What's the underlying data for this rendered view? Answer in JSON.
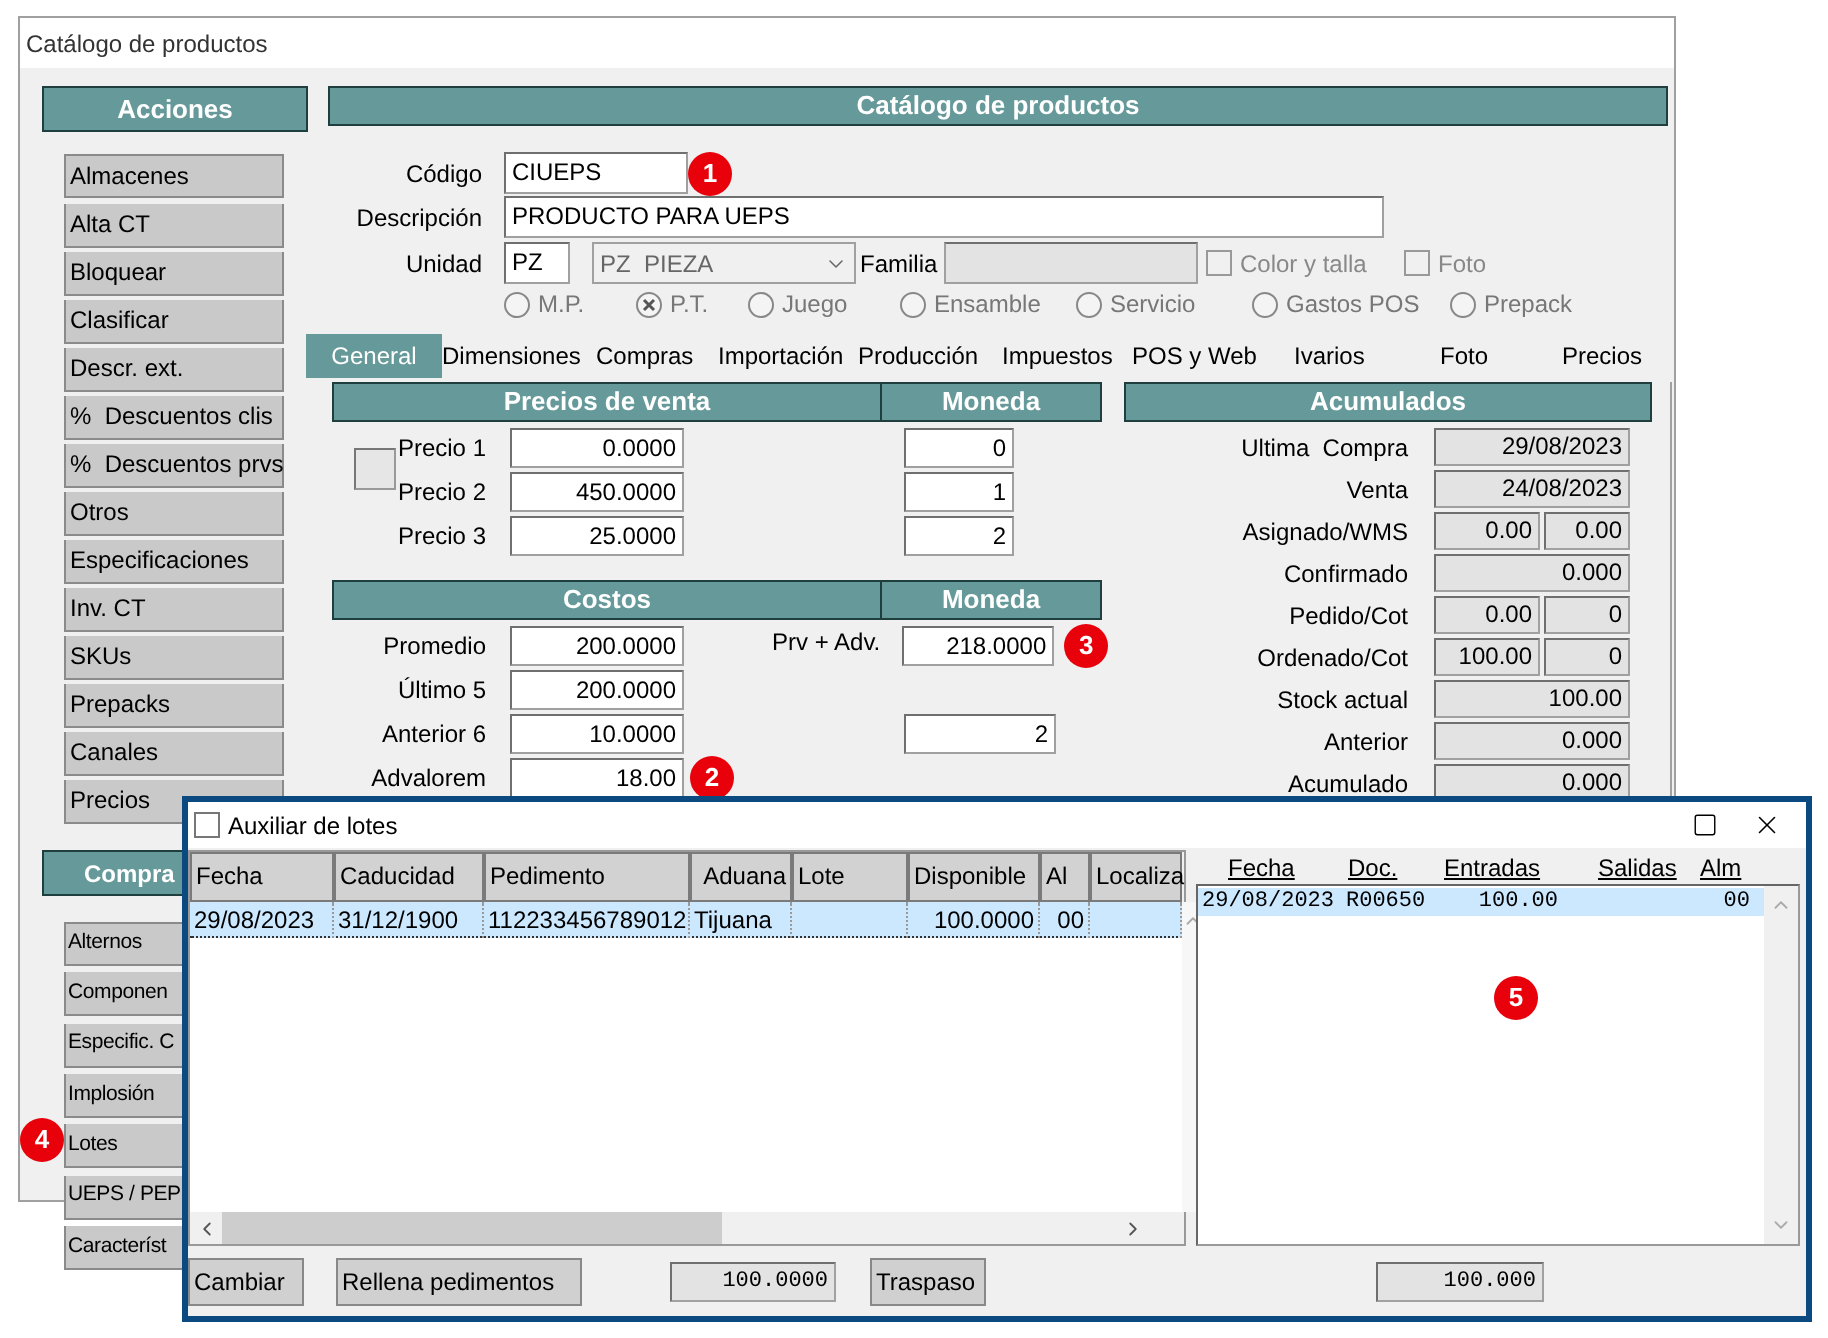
{
  "window": {
    "title": "Catálogo de productos"
  },
  "sidebar": [
    {
      "title": "Acciones",
      "items": [
        {
          "label": "Almacenes"
        },
        {
          "label": "Alta CT"
        },
        {
          "label": "Bloquear"
        },
        {
          "label": "Clasificar"
        },
        {
          "label": "Descr. ext."
        },
        {
          "label": "%  Descuentos clis"
        },
        {
          "label": "%  Descuentos prvs"
        },
        {
          "label": "Otros"
        },
        {
          "label": "Especificaciones"
        },
        {
          "label": "Inv. CT"
        },
        {
          "label": "SKUs"
        },
        {
          "label": "Prepacks"
        },
        {
          "label": "Canales"
        },
        {
          "label": "Precios"
        }
      ]
    },
    {
      "title": "Compra",
      "items": [
        {
          "label": "Alternos"
        },
        {
          "label": "Componen"
        },
        {
          "label": "Especific. C"
        },
        {
          "label": "Implosión"
        },
        {
          "label": "Lotes",
          "marker": "4"
        },
        {
          "label": "UEPS / PEP"
        },
        {
          "label": "Característ"
        }
      ]
    }
  ],
  "product": {
    "title": "Catálogo de productos",
    "code": {
      "label": "Código",
      "value": "CIUEPS",
      "marker": "1"
    },
    "description": {
      "label": "Descripción",
      "value": "PRODUCTO PARA UEPS"
    },
    "unit": {
      "label": "Unidad",
      "value": "PZ",
      "select": "PZ  PIEZA"
    },
    "family": {
      "label": "Familia",
      "disabled": true
    },
    "checkboxes": [
      {
        "label": "Color y talla",
        "checked": false,
        "disabled": true
      },
      {
        "label": "Foto",
        "checked": false,
        "disabled": true
      }
    ],
    "types": [
      {
        "label": "M.P.",
        "selected": false
      },
      {
        "label": "P.T.",
        "selected": true
      },
      {
        "label": "Juego",
        "selected": false
      },
      {
        "label": "Ensamble",
        "selected": false
      },
      {
        "label": "Servicio",
        "selected": false
      },
      {
        "label": "Gastos POS",
        "selected": false
      },
      {
        "label": "Prepack",
        "selected": false
      }
    ],
    "tabs": [
      {
        "label": "General",
        "selected": true
      },
      {
        "label": "Dimensiones",
        "selected": false
      },
      {
        "label": "Compras",
        "selected": false
      },
      {
        "label": "Importación",
        "selected": false
      },
      {
        "label": "Producción",
        "selected": false
      },
      {
        "label": "Impuestos",
        "selected": false
      },
      {
        "label": "POS y Web",
        "selected": false
      },
      {
        "label": "Ivarios",
        "selected": false
      },
      {
        "label": "Foto",
        "selected": false
      },
      {
        "label": "Precios",
        "selected": false
      }
    ],
    "sale_prices": {
      "title": "Precios de venta",
      "currency_title": "Moneda",
      "rows": [
        {
          "label": "Precio 1",
          "value": "0.0000",
          "currency": "0"
        },
        {
          "label": "Precio 2",
          "value": "450.0000",
          "currency": "1"
        },
        {
          "label": "Precio 3",
          "value": "25.0000",
          "currency": "2"
        }
      ]
    },
    "costs": {
      "title": "Costos",
      "currency_title": "Moneda",
      "rows": [
        {
          "label": "Promedio",
          "value": "200.0000",
          "side": {
            "label": "Prv + Adv.",
            "value": "218.0000",
            "marker": "3"
          }
        },
        {
          "label": "Último 5",
          "value": "200.0000"
        },
        {
          "label": "Anterior 6",
          "value": "10.0000",
          "currency": "2"
        },
        {
          "label": "Advalorem",
          "value": "18.00",
          "marker": "2"
        }
      ]
    },
    "accumulated": {
      "title": "Acumulados",
      "rows": [
        {
          "label": "Ultima  Compra",
          "values": [
            "29/08/2023"
          ]
        },
        {
          "label": "Venta",
          "values": [
            "24/08/2023"
          ]
        },
        {
          "label": "Asignado/WMS",
          "values": [
            "0.00",
            "0.00"
          ]
        },
        {
          "label": "Confirmado",
          "values": [
            "0.000"
          ]
        },
        {
          "label": "Pedido/Cot",
          "values": [
            "0.00",
            "0"
          ]
        },
        {
          "label": "Ordenado/Cot",
          "values": [
            "100.00",
            "0"
          ]
        },
        {
          "label": "Stock actual",
          "values": [
            "100.00"
          ]
        },
        {
          "label": "Anterior",
          "values": [
            "0.000"
          ]
        },
        {
          "label": "Acumulado",
          "values": [
            "0.000"
          ]
        }
      ]
    }
  },
  "dialog": {
    "title": "Auxiliar de lotes",
    "lots": {
      "columns": [
        "Fecha",
        "Caducidad",
        "Pedimento",
        "Aduana",
        "Lote",
        "Disponible",
        "Al",
        "Localiza"
      ],
      "rows": [
        {
          "selected": true,
          "cells": [
            "29/08/2023",
            "31/12/1900",
            "112233456789012",
            "Tijuana",
            null,
            "100.0000",
            "00",
            null
          ]
        }
      ]
    },
    "movements": {
      "columns": [
        "Fecha",
        "Doc.",
        "Entradas",
        "Salidas",
        "Alm"
      ],
      "marker": "5",
      "rows": [
        {
          "selected": true,
          "cells": [
            "29/08/2023",
            "R00650",
            "100.00",
            null,
            "00"
          ]
        }
      ]
    },
    "footer": [
      {
        "kind": "button",
        "label": "Cambiar"
      },
      {
        "kind": "button",
        "label": "Rellena pedimentos"
      },
      {
        "kind": "readout",
        "value": "100.0000"
      },
      {
        "kind": "button",
        "label": "Traspaso"
      },
      {
        "kind": "readout",
        "value": "100.000"
      }
    ]
  }
}
